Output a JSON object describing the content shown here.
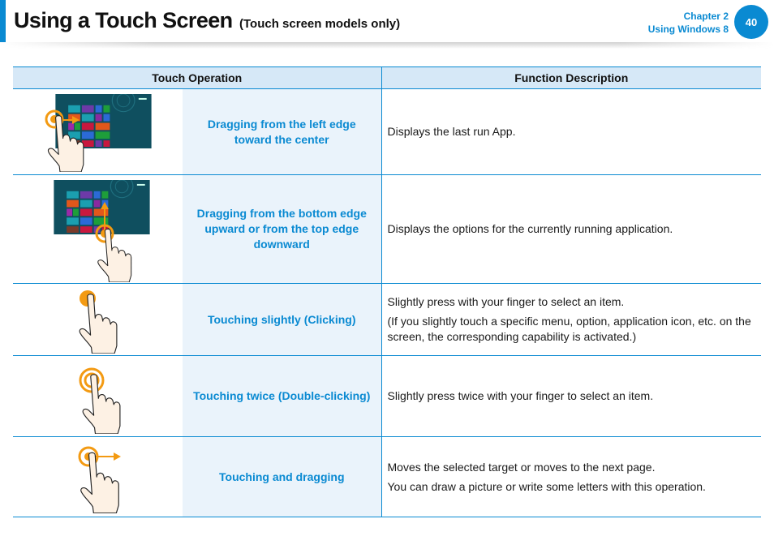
{
  "header": {
    "title": "Using a Touch Screen",
    "subtitle": "(Touch screen models only)",
    "chapter_line1": "Chapter 2",
    "chapter_line2": "Using Windows 8",
    "page_number": "40"
  },
  "table": {
    "columns": [
      "Touch Operation",
      "Function Description"
    ],
    "rows": [
      {
        "illustration": "swipe-left-edge-illustration",
        "operation": "Dragging from the left edge toward the center",
        "description": [
          "Displays the last run App."
        ]
      },
      {
        "illustration": "swipe-bottom-edge-illustration",
        "operation": "Dragging from the bottom edge upward or from the top edge downward",
        "description": [
          "Displays the options for the currently running application."
        ]
      },
      {
        "illustration": "tap-illustration",
        "operation": "Touching slightly (Clicking)",
        "description": [
          "Slightly press with your finger to select an item.",
          "(If you slightly touch a specific menu, option, application icon, etc. on the screen, the corresponding capability is activated.)"
        ]
      },
      {
        "illustration": "double-tap-illustration",
        "operation": "Touching twice (Double-clicking)",
        "description": [
          "Slightly press twice with your finger to select an item."
        ]
      },
      {
        "illustration": "touch-drag-illustration",
        "operation": "Touching and dragging",
        "description": [
          "Moves the selected target or moves to the next page.",
          "You can draw a picture or write some letters with this operation."
        ]
      }
    ]
  },
  "colors": {
    "accent": "#0a8ad2",
    "header_bg": "#d6e8f7",
    "operation_bg": "#eaf3fb",
    "gesture_orange": "#f39a12",
    "screen_bg": "#0f4f5f"
  }
}
